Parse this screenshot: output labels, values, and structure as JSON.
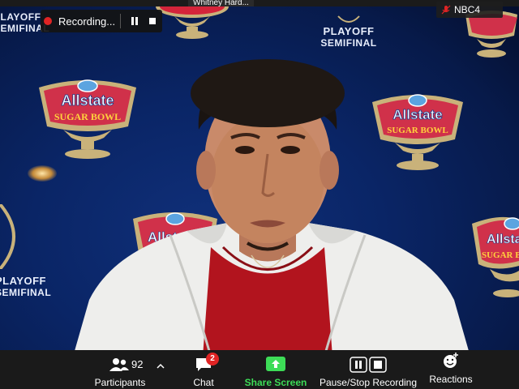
{
  "top_bar": {
    "name_tag": "Whitney Hard...",
    "recording_label": "Recording...",
    "nbc_label": "NBC4"
  },
  "backdrop": {
    "brand_top": "Allstate",
    "brand_bottom": "SUGAR BOWL",
    "playoff_line1": "PLAYOFF",
    "playoff_line2": "SEMIFINAL",
    "partial_playoff_line1": "PLAYOFF",
    "partial_playoff_line2": "SEMIFINAL",
    "partial_left_top1": "PLAYOFF",
    "partial_left_top2": "SEMIFINAL",
    "logo_fragment_allst": "Allst"
  },
  "toolbar": {
    "participants_label": "Participants",
    "participants_count": "92",
    "chat_label": "Chat",
    "chat_badge": "2",
    "share_label": "Share Screen",
    "record_label": "Pause/Stop Recording",
    "reactions_label": "Reactions"
  },
  "colors": {
    "toolbar_bg": "#1a1a1a",
    "share_green": "#3ddc57",
    "badge_red": "#e02424",
    "backdrop_blue": "#0a2566"
  }
}
